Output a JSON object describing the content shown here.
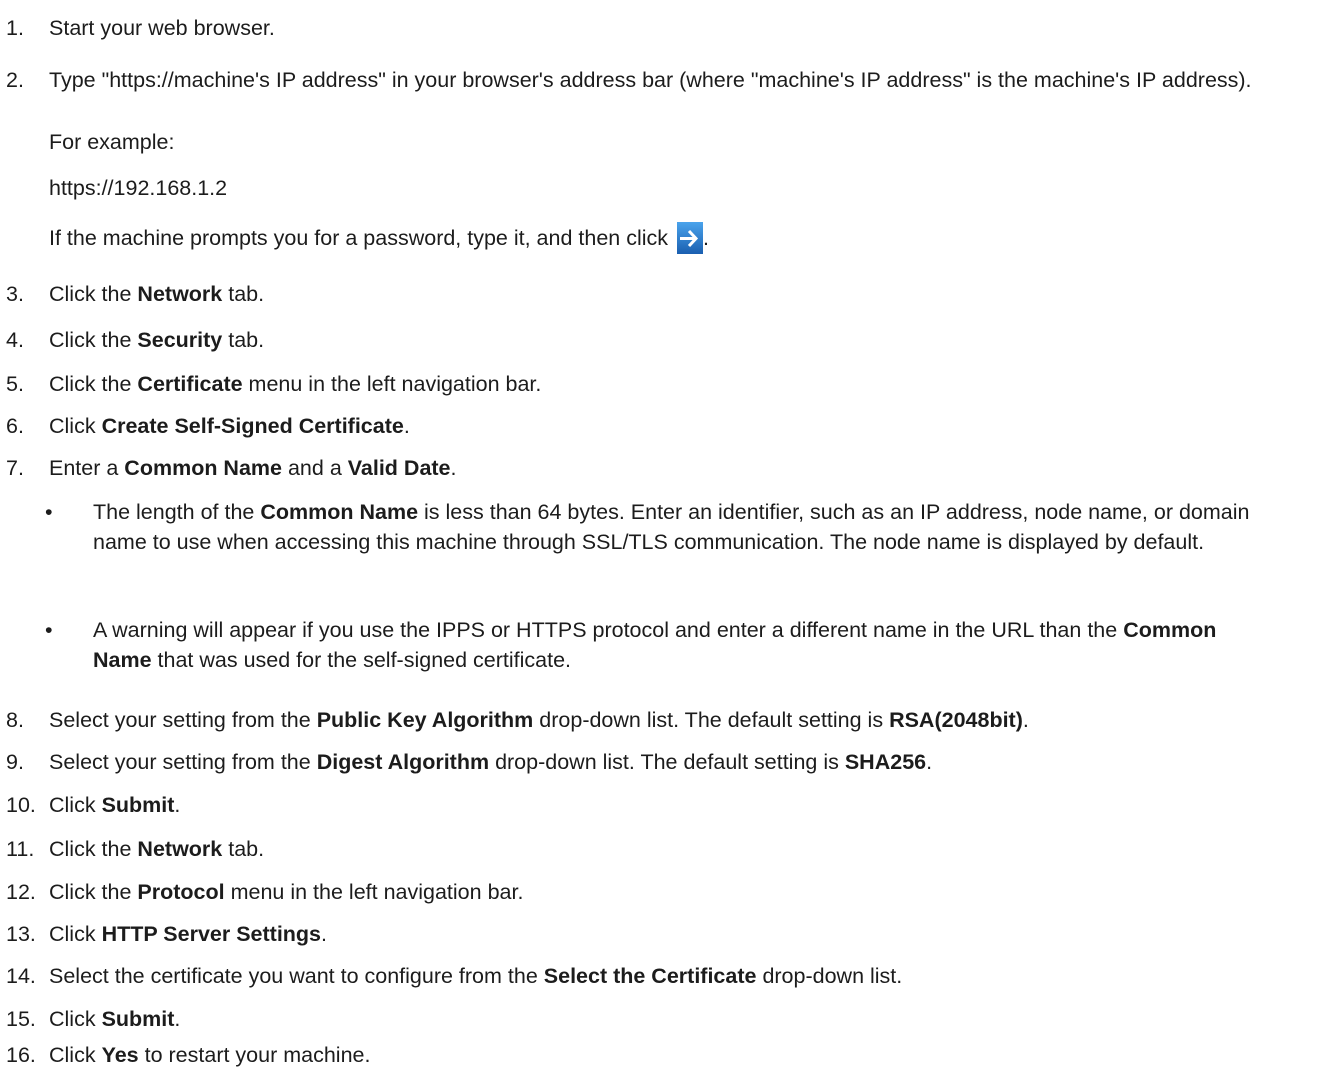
{
  "steps": {
    "s1": {
      "num": "1.",
      "text": "Start your web browser."
    },
    "s2": {
      "num": "2.",
      "text": "Type \"https://machine's IP address\" in your browser's address bar (where \"machine's IP address\" is the machine's IP address).",
      "example_label": "For example:",
      "example_url": "https://192.168.1.2",
      "prompt_text": "If the machine prompts you for a password, type it, and then click",
      "prompt_end": "."
    },
    "s3": {
      "num": "3.",
      "pre": "Click the ",
      "bold": "Network",
      "post": " tab."
    },
    "s4": {
      "num": "4.",
      "pre": "Click the ",
      "bold": "Security",
      "post": " tab."
    },
    "s5": {
      "num": "5.",
      "pre": "Click the ",
      "bold": "Certificate",
      "post": " menu in the left navigation bar."
    },
    "s6": {
      "num": "6.",
      "pre": "Click ",
      "bold": "Create Self-Signed Certificate",
      "post": "."
    },
    "s7": {
      "num": "7.",
      "pre": "Enter a ",
      "bold1": "Common Name",
      "mid": " and a ",
      "bold2": "Valid Date",
      "post": ".",
      "bullet1": {
        "pre": "The length of the ",
        "bold": "Common Name",
        "post": " is less than 64 bytes. Enter an identifier, such as an IP address, node name, or domain name to use when accessing this machine through SSL/TLS communication. The node name is displayed by default."
      },
      "bullet2": {
        "pre": "A warning will appear if you use the IPPS or HTTPS protocol and enter a different name in the URL than the ",
        "bold": "Common Name",
        "post": " that was used for the self-signed certificate."
      },
      "bullet_char": "•"
    },
    "s8": {
      "num": "8.",
      "pre": "Select your setting from the ",
      "bold1": "Public Key Algorithm",
      "mid": " drop-down list. The default setting is ",
      "bold2": "RSA(2048bit)",
      "post": "."
    },
    "s9": {
      "num": "9.",
      "pre": "Select your setting from the ",
      "bold1": "Digest Algorithm",
      "mid": " drop-down list. The default setting is ",
      "bold2": "SHA256",
      "post": "."
    },
    "s10": {
      "num": "10.",
      "pre": "Click ",
      "bold": "Submit",
      "post": "."
    },
    "s11": {
      "num": "11.",
      "pre": "Click the ",
      "bold": "Network",
      "post": " tab."
    },
    "s12": {
      "num": "12.",
      "pre": "Click the ",
      "bold": "Protocol",
      "post": " menu in the left navigation bar."
    },
    "s13": {
      "num": "13.",
      "pre": "Click ",
      "bold": "HTTP Server Settings",
      "post": "."
    },
    "s14": {
      "num": "14.",
      "pre": "Select the certificate you want to configure from the ",
      "bold": "Select the Certificate",
      "post": " drop-down list."
    },
    "s15": {
      "num": "15.",
      "pre": "Click ",
      "bold": "Submit",
      "post": "."
    },
    "s16": {
      "num": "16.",
      "pre": "Click ",
      "bold": "Yes",
      "post": " to restart your machine."
    }
  },
  "icons": {
    "go_button": "arrow-right-icon",
    "go_color_top": "#3a8fdc",
    "go_color_bottom": "#1a5fb0"
  }
}
